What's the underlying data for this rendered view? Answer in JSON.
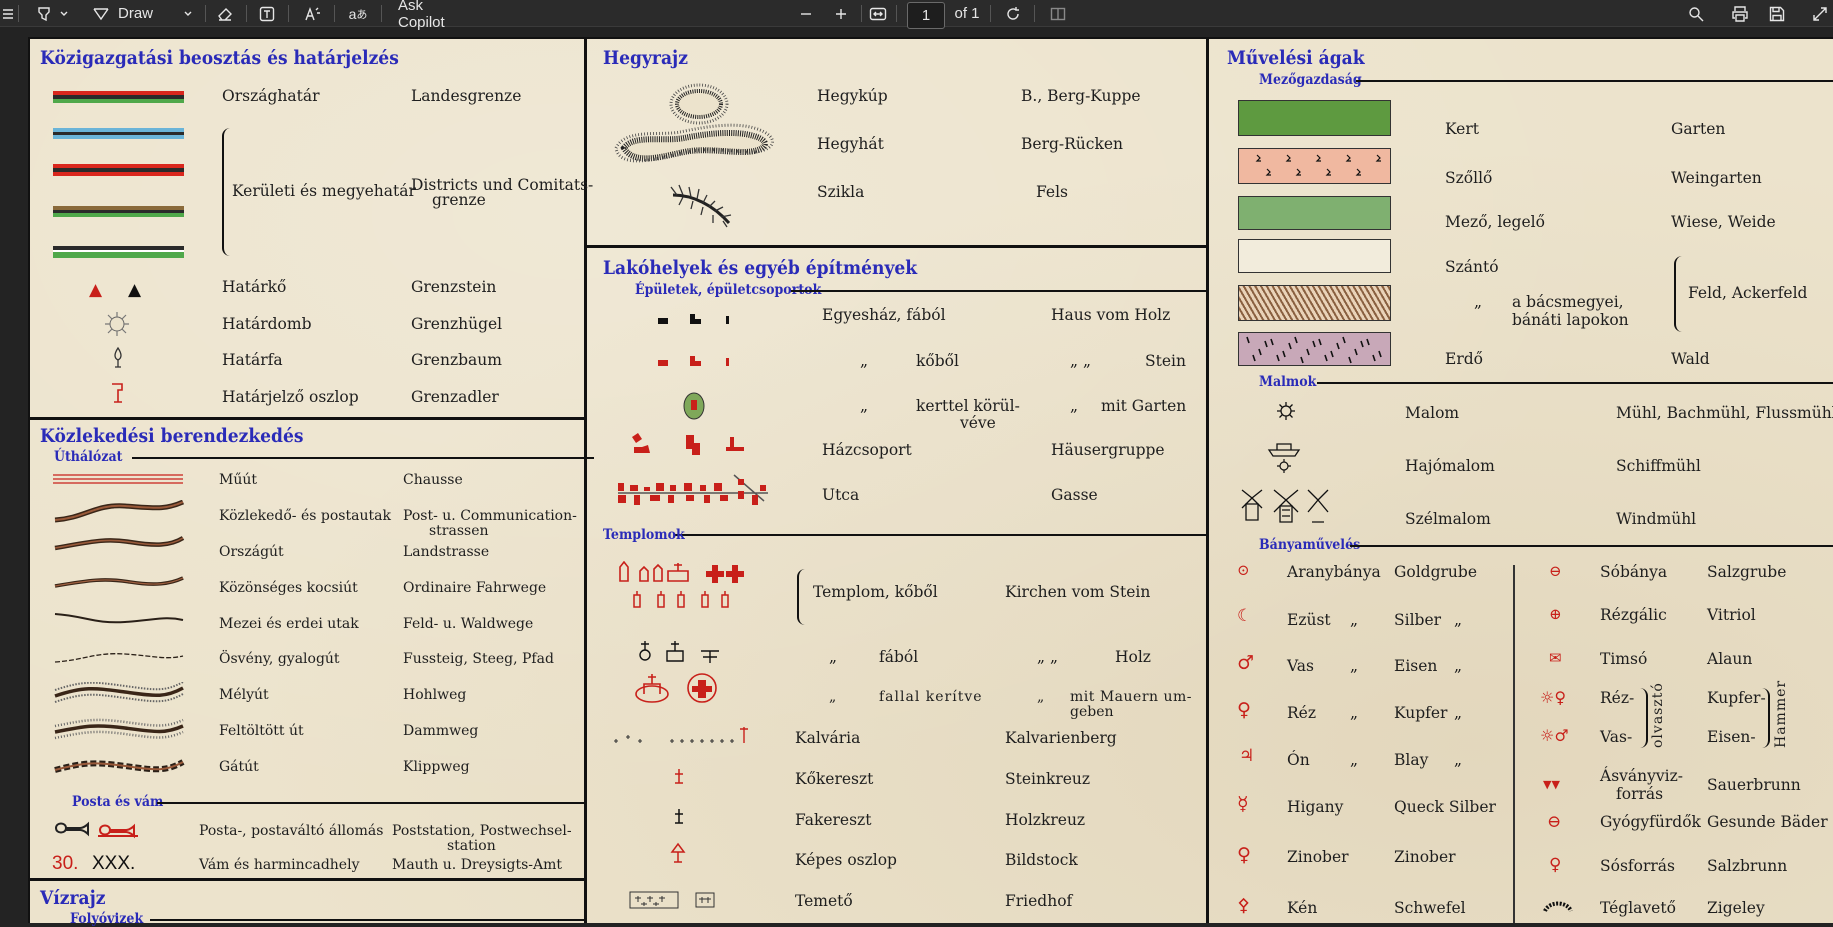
{
  "toolbar": {
    "draw_label": "Draw",
    "ask_copilot": "Ask Copilot",
    "page_value": "1",
    "page_total": "of 1"
  },
  "icons": [
    "menu-icon",
    "highlight-icon",
    "draw-icon",
    "eraser-icon",
    "text-box-icon",
    "read-aloud-icon",
    "translate-icon",
    "zoom-out-icon",
    "zoom-in-icon",
    "fit-page-icon",
    "rotate-icon",
    "two-page-icon",
    "search-icon",
    "print-icon",
    "save-icon",
    "expand-icon"
  ],
  "c1": {
    "title": "Közigazgatási beosztás és határjelzés",
    "rows": [
      {
        "hu": "Országhatár",
        "de": "Landesgrenze"
      },
      {
        "hu": "Kerületi és megyehatár",
        "de": "Districts und Comitats-",
        "de2": "grenze"
      },
      {
        "hu": "Határkő",
        "de": "Grenzstein"
      },
      {
        "hu": "Határdomb",
        "de": "Grenzhügel"
      },
      {
        "hu": "Határfa",
        "de": "Grenzbaum"
      },
      {
        "hu": "Határjelző oszlop",
        "de": "Grenzadler"
      }
    ],
    "kozl_title": "Közlekedési berendezkedés",
    "uthalozat": "Úthálózat",
    "roads": [
      {
        "hu": "Műút",
        "de": "Chausse"
      },
      {
        "hu": "Közlekedő- és postautak",
        "de": "Post- u. Communication-",
        "de2": "strassen"
      },
      {
        "hu": "Országút",
        "de": "Landstrasse"
      },
      {
        "hu": "Közönséges kocsiút",
        "de": "Ordinaire Fahrwege"
      },
      {
        "hu": "Mezei és erdei utak",
        "de": "Feld- u. Waldwege"
      },
      {
        "hu": "Ösvény, gyalogút",
        "de": "Fussteig, Steeg, Pfad"
      },
      {
        "hu": "Mélyút",
        "de": "Hohlweg"
      },
      {
        "hu": "Feltöltött út",
        "de": "Dammweg"
      },
      {
        "hu": "Gátút",
        "de": "Klippweg"
      }
    ],
    "posta_title": "Posta és vám",
    "posta": [
      {
        "hu": "Posta-, postaváltó állomás",
        "de": "Poststation, Postwechsel-",
        "de2": "station"
      },
      {
        "hu": "Vám és harmincadhely",
        "de": "Mauth u. Dreysigts-Amt",
        "sym1": "30.",
        "sym2": "XXX."
      }
    ],
    "vizrajz": "Vízrajz",
    "folyovizek": "Folyóvizek"
  },
  "c2": {
    "title": "Hegyrajz",
    "rows": [
      {
        "hu": "Hegykúp",
        "de": "B., Berg-Kuppe"
      },
      {
        "hu": "Hegyhát",
        "de": "Berg-Rücken"
      },
      {
        "hu": "Szikla",
        "de": "Fels"
      }
    ],
    "lak_title": "Lakóhelyek és egyéb építmények",
    "epuletek": "Épületek, épületcsoportok",
    "ep": [
      {
        "hu": "Egyesház,  fából",
        "de": "Haus vom Holz"
      },
      {
        "q1": "„",
        "hu": "kőből",
        "q2": "„     „",
        "de": "Stein"
      },
      {
        "q1": "„",
        "hu": "kerttel körül-",
        "hu2": "véve",
        "q2": "„",
        "de": "mit Garten"
      },
      {
        "hu": "Házcsoport",
        "de": "Häusergruppe"
      },
      {
        "hu": "Utca",
        "de": "Gasse"
      }
    ],
    "templomok": "Templomok",
    "tp": [
      {
        "hu": "Templom,  kőből",
        "de": "Kirchen vom Stein"
      },
      {
        "q1": "„",
        "hu": "fából",
        "q2": "„     „",
        "de": "Holz"
      },
      {
        "q1": "„",
        "hu": "fallal kerítve",
        "q2": "„",
        "de": "mit Mauern  um-",
        "de2": "geben"
      },
      {
        "hu": "Kalvária",
        "de": "Kalvarienberg"
      },
      {
        "hu": "Kőkereszt",
        "de": "Steinkreuz"
      },
      {
        "hu": "Fakereszt",
        "de": "Holzkreuz"
      },
      {
        "hu": "Képes oszlop",
        "de": "Bildstock"
      },
      {
        "hu": "Temető",
        "de": "Friedhof"
      }
    ]
  },
  "c3": {
    "title": "Művelési ágak",
    "mezo": "Mezőgazdaság",
    "mg": [
      {
        "hu": "Kert",
        "de": "Garten"
      },
      {
        "hu": "Szőllő",
        "de": "Weingarten"
      },
      {
        "hu": "Mező, legelő",
        "de": "Wiese, Weide"
      },
      {
        "hu": "Szántó",
        "de": "Feld, Ackerfeld"
      },
      {
        "q1": "„",
        "hu": "a bácsmegyei,",
        "hu2": "bánáti lapokon"
      },
      {
        "hu": "Erdő",
        "de": "Wald"
      }
    ],
    "malmok": "Malmok",
    "ml": [
      {
        "hu": "Malom",
        "de": "Mühl, Bachmühl, Flussmühl"
      },
      {
        "hu": "Hajómalom",
        "de": "Schiffmühl"
      },
      {
        "hu": "Szélmalom",
        "de": "Windmühl"
      }
    ],
    "banya": "Bányaművelés",
    "bl": [
      {
        "hu": "Aranybánya",
        "de": "Goldgrube",
        "q1": "",
        "q2": ""
      },
      {
        "hu": "Ezüst",
        "q1": "„",
        "de": "Silber",
        "q2": "„"
      },
      {
        "hu": "Vas",
        "q1": "„",
        "de": "Eisen",
        "q2": "„"
      },
      {
        "hu": "Réz",
        "q1": "„",
        "de": "Kupfer",
        "q2": "„"
      },
      {
        "hu": "Ón",
        "q1": "„",
        "de": "Blay",
        "q2": "„"
      },
      {
        "hu": "Higany",
        "de": "Queck Silber"
      },
      {
        "hu": "Zinober",
        "de": "Zinober"
      },
      {
        "hu": "Kén",
        "de": "Schwefel"
      }
    ],
    "br": [
      {
        "hu": "Sóbánya",
        "de": "Salzgrube"
      },
      {
        "hu": "Rézgálic",
        "de": "Vitriol"
      },
      {
        "hu": "Timsó",
        "de": "Alaun"
      },
      {
        "hu": "Réz-",
        "de": "Kupfer-"
      },
      {
        "hu": "Vas-",
        "de": "Eisen-"
      },
      {
        "hu": "Ásványviz-",
        "hu2": "forrás",
        "de": "Sauerbrunn"
      },
      {
        "hu": "Gyógyfürdők",
        "de": "Gesunde Bäder"
      },
      {
        "hu": "Sósforrás",
        "de": "Salzbrunn"
      },
      {
        "hu": "Téglavető",
        "de": "Zigeley"
      }
    ],
    "olvaszto": "olvasztó",
    "hammer": "Hammer"
  }
}
